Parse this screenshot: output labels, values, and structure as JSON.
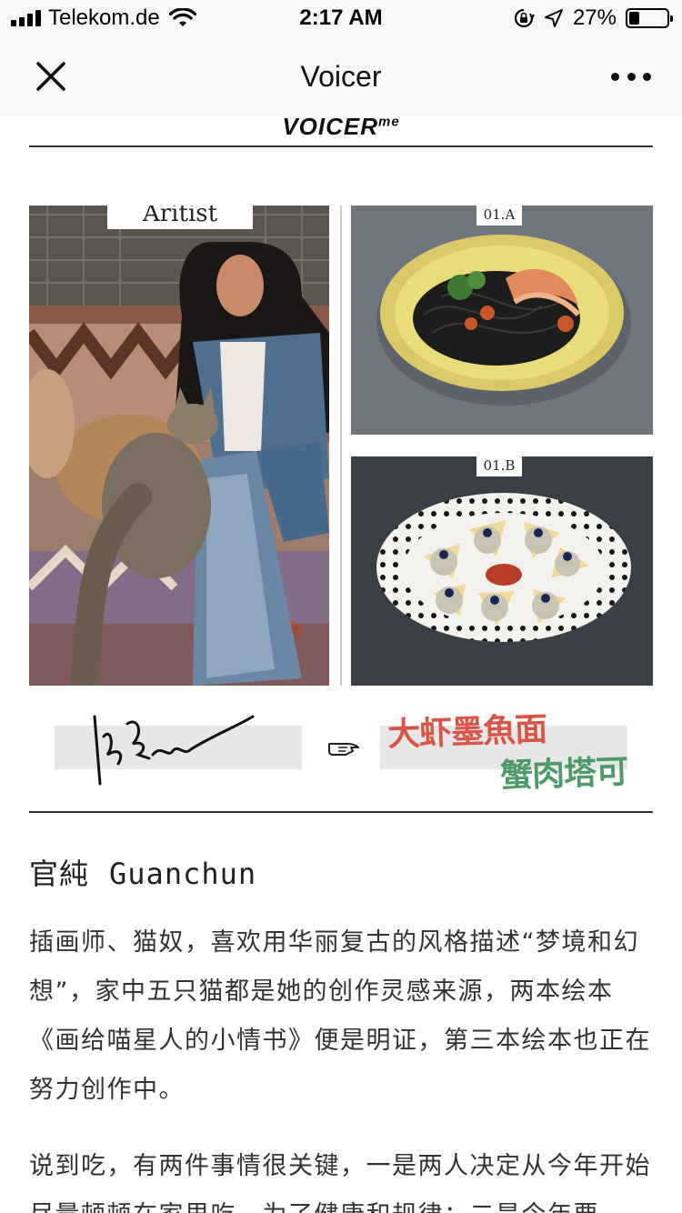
{
  "status_bar": {
    "carrier": "Telekom.de",
    "time": "2:17 AM",
    "battery": "27%",
    "battery_level": 0.27,
    "icons": [
      "signal-bars-icon",
      "wifi-icon",
      "orientation-lock-icon",
      "location-arrow-icon",
      "battery-icon"
    ]
  },
  "nav": {
    "title": "Voicer",
    "close_icon": "close-icon",
    "more_icon": "more-dots-icon"
  },
  "poster": {
    "brand": "VOICER",
    "brand_sup": "me",
    "artist_label": "Aritist",
    "dish_a_tag": "01.A",
    "dish_b_tag": "01.B",
    "dish_name_1": "大虾墨魚面",
    "dish_name_2": "蟹肉塔可",
    "pointer_icon": "pointing-hand-icon"
  },
  "article": {
    "name_cn": "官純",
    "name_en": "Guanchun",
    "paragraph_1": "插画师、猫奴，喜欢用华丽复古的风格描述“梦境和幻想”，家中五只猫都是她的创作灵感来源，两本绘本《画给喵星人的小情书》便是明证，第三本绘本也正在努力创作中。",
    "paragraph_2": "说到吃，有两件事情很关键，一是两人决定从今年开始尽量顿顿在家里吃，为了健康和规律；二是今年要"
  }
}
